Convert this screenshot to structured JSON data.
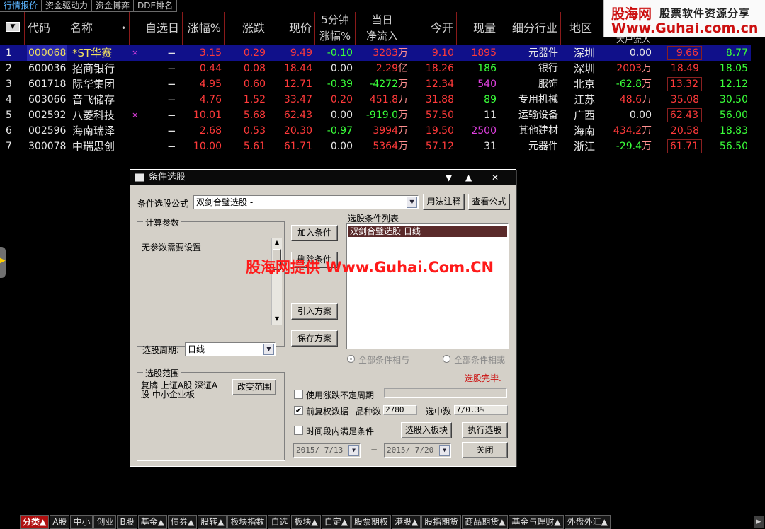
{
  "top_tabs": [
    "行情报价",
    "资金驱动力",
    "资金博弈",
    "DDE排名"
  ],
  "header": {
    "dropdown_icon": "▼",
    "code": "代码",
    "name": "名称",
    "dot": "•",
    "selday": "自选日",
    "zf": "涨幅%",
    "zd": "涨跌",
    "xj": "现价",
    "min5": "5分钟",
    "min5_zf": "涨幅%",
    "today": "当日",
    "today_jlr": "净流入",
    "jk": "今开",
    "xl": "现量",
    "hy": "细分行业",
    "dq": "地区",
    "extra_partial": "大户流入"
  },
  "banner": {
    "logo_text": "股海网",
    "slogan": "股票软件资源分享",
    "url": "Www.Guhai.com.cn"
  },
  "rows": [
    {
      "idx": "1",
      "code": "000068",
      "name": "*ST华赛",
      "star": "×",
      "sel": "−",
      "zf": "3.15",
      "zd": "0.29",
      "xj": "9.49",
      "m5": "-0.10",
      "jlr": "3283",
      "jlr_unit": "万",
      "jk": "9.10",
      "xl": "1895",
      "hy": "元器件",
      "dq": "深圳",
      "x1": "0.00",
      "x1_unit": "",
      "x2": "9.66",
      "x3": "8.77"
    },
    {
      "idx": "2",
      "code": "600036",
      "name": "招商银行",
      "star": "",
      "sel": "−",
      "zf": "0.44",
      "zd": "0.08",
      "xj": "18.44",
      "m5": "0.00",
      "jlr": "2.29",
      "jlr_unit": "亿",
      "jk": "18.26",
      "xl": "186",
      "hy": "银行",
      "dq": "深圳",
      "x1": "2003",
      "x1_unit": "万",
      "x2": "18.49",
      "x3": "18.05"
    },
    {
      "idx": "3",
      "code": "601718",
      "name": "际华集团",
      "star": "",
      "sel": "−",
      "zf": "4.95",
      "zd": "0.60",
      "xj": "12.71",
      "m5": "-0.39",
      "jlr": "-4272",
      "jlr_unit": "万",
      "jk": "12.34",
      "xl": "540",
      "hy": "服饰",
      "dq": "北京",
      "x1": "-62.8",
      "x1_unit": "万",
      "x2": "13.32",
      "x3": "12.12"
    },
    {
      "idx": "4",
      "code": "603066",
      "name": "音飞储存",
      "star": "",
      "sel": "−",
      "zf": "4.76",
      "zd": "1.52",
      "xj": "33.47",
      "m5": "0.20",
      "jlr": "451.8",
      "jlr_unit": "万",
      "jk": "31.88",
      "xl": "89",
      "hy": "专用机械",
      "dq": "江苏",
      "x1": "48.6",
      "x1_unit": "万",
      "x2": "35.08",
      "x3": "30.50"
    },
    {
      "idx": "5",
      "code": "002592",
      "name": "八菱科技",
      "star": "×",
      "sel": "−",
      "zf": "10.01",
      "zd": "5.68",
      "xj": "62.43",
      "m5": "0.00",
      "jlr": "-919.0",
      "jlr_unit": "万",
      "jk": "57.50",
      "xl": "11",
      "hy": "运输设备",
      "dq": "广西",
      "x1": "0.00",
      "x1_unit": "",
      "x2": "62.43",
      "x3": "56.00"
    },
    {
      "idx": "6",
      "code": "002596",
      "name": "海南瑞泽",
      "star": "",
      "sel": "−",
      "zf": "2.68",
      "zd": "0.53",
      "xj": "20.30",
      "m5": "-0.97",
      "jlr": "3994",
      "jlr_unit": "万",
      "jk": "19.50",
      "xl": "2500",
      "hy": "其他建材",
      "dq": "海南",
      "x1": "434.2",
      "x1_unit": "万",
      "x2": "20.58",
      "x3": "18.83"
    },
    {
      "idx": "7",
      "code": "300078",
      "name": "中瑞思创",
      "star": "",
      "sel": "−",
      "zf": "10.00",
      "zd": "5.61",
      "xj": "61.71",
      "m5": "0.00",
      "jlr": "5364",
      "jlr_unit": "万",
      "jk": "57.12",
      "xl": "31",
      "hy": "元器件",
      "dq": "浙江",
      "x1": "-29.4",
      "x1_unit": "万",
      "x2": "61.71",
      "x3": "56.50"
    }
  ],
  "dialog": {
    "title": "条件选股",
    "ctrl_min": "▼",
    "ctrl_max": "▲",
    "ctrl_close": "✕",
    "formula_label": "条件选股公式",
    "formula_value": "双剑合璧选股 -",
    "btn_usage": "用法注释",
    "btn_view": "查看公式",
    "params_title": "计算参数",
    "params_text": "无参数需要设置",
    "btn_add": "加入条件",
    "btn_del": "删除条件",
    "btn_import": "引入方案",
    "btn_save": "保存方案",
    "cond_list_title": "选股条件列表",
    "cond_item": "双剑合璧选股  日线",
    "period_label": "选股周期:",
    "period_value": "日线",
    "radio_and": "全部条件相与",
    "radio_or": "全部条件相或",
    "status": "选股完毕.",
    "range_title": "选股范围",
    "range_text": "复牌 上证A股 深证A股 中小企业板",
    "btn_range": "改变范围",
    "chk_uncertain": "使用涨跌不定周期",
    "chk_fq": "前复权数据",
    "varieties_label": "品种数",
    "varieties_value": "2780",
    "selected_label": "选中数",
    "selected_value": "7/0.3%",
    "chk_period": "时间段内满足条件",
    "btn_to_block": "选股入板块",
    "btn_exec": "执行选股",
    "btn_close": "关闭",
    "date_from": "2015/ 7/13",
    "date_sep": "−",
    "date_to": "2015/ 7/20"
  },
  "watermark": "股海网提供 Www.Guhai.Com.CN",
  "bottom_tabs": [
    "分类▲",
    "A股",
    "中小",
    "创业",
    "B股",
    "基金▲",
    "债券▲",
    "股转▲",
    "板块指数",
    "自选",
    "板块▲",
    "自定▲",
    "股票期权",
    "港股▲",
    "股指期货",
    "商品期货▲",
    "基金与理财▲",
    "外盘外汇▲"
  ],
  "colors": {
    "up": "#ff3a3a",
    "down": "#3aff3a",
    "code": "#f0e060",
    "selected_row": "#10108a",
    "accent": "#b01010"
  }
}
